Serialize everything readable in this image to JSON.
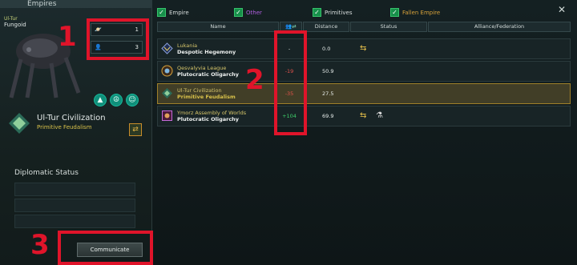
{
  "left_panel": {
    "title": "Empires",
    "species_name": "Ul-Tur",
    "species_type": "Fungoid",
    "stats": [
      {
        "icon": "planet-icon",
        "value": "1"
      },
      {
        "icon": "pop-icon",
        "value": "3"
      }
    ],
    "ethics_icons": [
      "triangle-icon",
      "pacifist-icon",
      "egalitarian-icon"
    ],
    "civ_name": "Ul-Tur Civilization",
    "civ_government": "Primitive Feudalism",
    "diplomatic_status_label": "Diplomatic Status",
    "communicate_label": "Communicate"
  },
  "filters": [
    {
      "label": "Empire",
      "color": "#d8dedd"
    },
    {
      "label": "Other",
      "color": "#b15ee0"
    },
    {
      "label": "Primitives",
      "color": "#d8dedd"
    },
    {
      "label": "Fallen Empire",
      "color": "#d8a23a"
    }
  ],
  "table": {
    "columns": [
      "Name",
      "",
      "Distance",
      "Status",
      "Alliance/Federation"
    ],
    "rows": [
      {
        "name": "Lukania",
        "government": "Despotic Hegemony",
        "opinion": "-",
        "opinion_color": "#e6ecea",
        "distance": "0.0",
        "status": [
          "trade-arrows-icon"
        ]
      },
      {
        "name": "Qesvalyvia League",
        "government": "Plutocratic Oligarchy",
        "opinion": "-19",
        "opinion_color": "#e0524a",
        "distance": "50.9",
        "status": []
      },
      {
        "name": "Ul-Tur Civilization",
        "government": "Primitive Feudalism",
        "opinion": "-35",
        "opinion_color": "#e0524a",
        "distance": "27.5",
        "status": []
      },
      {
        "name": "Ymorz Assembly of Worlds",
        "government": "Plutocratic Oligarchy",
        "opinion": "+104",
        "opinion_color": "#3fd06a",
        "distance": "69.9",
        "status": [
          "trade-arrows-icon",
          "research-agreement-icon"
        ]
      }
    ]
  },
  "annotations": [
    "1",
    "2",
    "3"
  ]
}
